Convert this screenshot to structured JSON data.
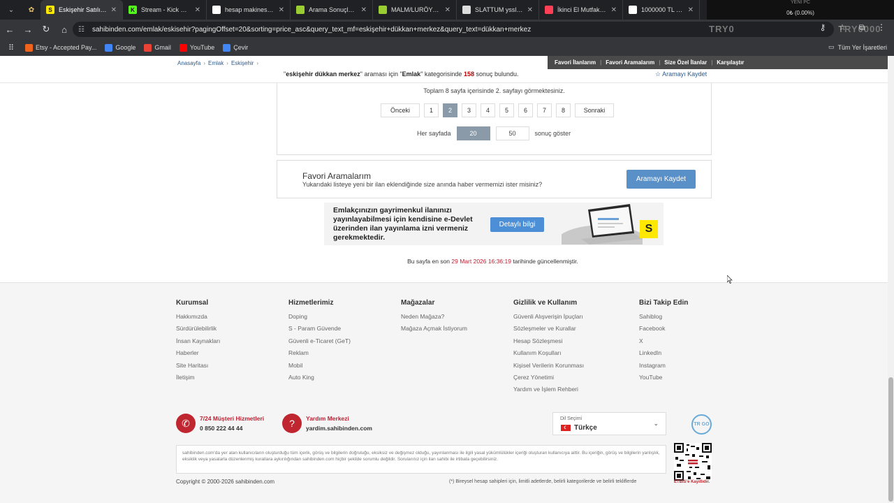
{
  "browser": {
    "tabs": [
      {
        "title": "Eskişehir Satılık, Kira",
        "icon": "sahibinden-icon",
        "active": true,
        "color": "#ffe800"
      },
      {
        "title": "Stream - Kick Dashb",
        "icon": "kick-icon",
        "active": false,
        "color": "#53fc18"
      },
      {
        "title": "hesap makinesi - Go",
        "icon": "google-icon",
        "active": false,
        "color": "#ffffff"
      },
      {
        "title": "Arama Sonuçları | İK",
        "icon": "ikea-icon",
        "active": false,
        "color": "#9acd32"
      },
      {
        "title": "MALM/LURÖY beya",
        "icon": "ikea-icon",
        "active": false,
        "color": "#9acd32"
      },
      {
        "title": "SLATTUM yssle koy",
        "icon": "page-icon",
        "active": false,
        "color": "#dddddd"
      },
      {
        "title": "İkinci El Mutfak Ma",
        "icon": "letgo-icon",
        "active": false,
        "color": "#ff3f55"
      },
      {
        "title": "1000000 TL 12 Ay Va",
        "icon": "bank-icon",
        "active": false,
        "color": "#ffffff"
      }
    ],
    "ticker": {
      "line1": "YENİ PC",
      "line2": "0₺ (0.00%)"
    },
    "url": "sahibinden.com/emlak/eskisehir?pagingOffset=20&sorting=price_asc&query_text_mf=eskişehir+dükkan+merkez&query_text=dükkan+merkez",
    "overlay_text": "TRY0",
    "overlay_text2": "TRY0000",
    "bookmarks": [
      {
        "label": "Etsy - Accepted Pay...",
        "icon": "etsy-icon",
        "color": "#f1641e"
      },
      {
        "label": "Google",
        "icon": "google-icon",
        "color": "#4285f4"
      },
      {
        "label": "Gmail",
        "icon": "gmail-icon",
        "color": "#ea4335"
      },
      {
        "label": "YouTube",
        "icon": "youtube-icon",
        "color": "#ff0000"
      },
      {
        "label": "Çevir",
        "icon": "translate-icon",
        "color": "#4285f4"
      }
    ],
    "all_bookmarks": "Tüm Yer İşaretleri"
  },
  "breadcrumb": [
    "Anasayfa",
    "Emlak",
    "Eskişehir"
  ],
  "topnav": [
    "Favori İlanlarım",
    "Favori Aramalarım",
    "Size Özel İlanlar",
    "Karşılaştır"
  ],
  "results": {
    "query": "eskişehir dükkan merkez",
    "pre": "\"",
    "mid1": "\" araması için \"",
    "category": "Emlak",
    "mid2": "\" kategorisinde",
    "count": "158",
    "post": "sonuç bulundu.",
    "save": "Aramayı Kaydet"
  },
  "pagination": {
    "info": "Toplam 8 sayfa içerisinde 2. sayfayı görmektesiniz.",
    "prev": "Önceki",
    "next": "Sonraki",
    "pages": [
      "1",
      "2",
      "3",
      "4",
      "5",
      "6",
      "7",
      "8"
    ],
    "current": "2",
    "per_page_label": "Her sayfada",
    "per_page_options": [
      "20",
      "50"
    ],
    "per_page_selected": "20",
    "per_page_suffix": "sonuç göster"
  },
  "favorites": {
    "title": "Favori Aramalarım",
    "desc": "Yukarıdaki listeye yeni bir ilan eklendiğinde size anında haber vermemizi ister misiniz?",
    "button": "Aramayı Kaydet"
  },
  "banner": {
    "text": "Emlakçınızın gayrimenkul ilanınızı yayınlayabilmesi için kendisine e-Devlet üzerinden ilan yayınlama izni vermeniz gerekmektedir.",
    "button": "Detaylı bilgi",
    "logo": "S"
  },
  "updated": {
    "pre": "Bu sayfa en son",
    "date": "29 Mart 2026 16:36:19",
    "post": "tarihinde güncellenmiştir."
  },
  "footer": {
    "columns": [
      {
        "title": "Kurumsal",
        "items": [
          "Hakkımızda",
          "Sürdürülebilirlik",
          "İnsan Kaynakları",
          "Haberler",
          "Site Haritası",
          "İletişim"
        ]
      },
      {
        "title": "Hizmetlerimiz",
        "items": [
          "Doping",
          "S - Param Güvende",
          "Güvenli e-Ticaret (GeT)",
          "Reklam",
          "Mobil",
          "Auto King"
        ]
      },
      {
        "title": "Mağazalar",
        "items": [
          "Neden Mağaza?",
          "Mağaza Açmak İstiyorum"
        ]
      },
      {
        "title": "Gizlilik ve Kullanım",
        "items": [
          "Güvenli Alışverişin İpuçları",
          "Sözleşmeler ve Kurallar",
          "Hesap Sözleşmesi",
          "Kullanım Koşulları",
          "Kişisel Verilerin Korunması",
          "Çerez Yönetimi",
          "Yardım ve İşlem Rehberi"
        ]
      },
      {
        "title": "Bizi Takip Edin",
        "items": [
          "Sahiblog",
          "Facebook",
          "X",
          "LinkedIn",
          "Instagram",
          "YouTube"
        ]
      }
    ],
    "support": {
      "title": "7/24 Müşteri Hizmetleri",
      "value": "0 850 222 44 44"
    },
    "help": {
      "title": "Yardım Merkezi",
      "value": "yardim.sahibinden.com"
    },
    "language": {
      "label": "Dil Seçimi",
      "value": "Türkçe"
    },
    "trgo": "TR GO",
    "disclaimer": "sahibinden.com'da yer alan kullanıcıların oluşturduğu tüm içerik, görüş ve bilgilerin doğruluğu, eksiksiz ve değişmez olduğu, yayınlanması ile ilgili yasal yükümlülükler içeriği oluşturan kullanıcıya aittir. Bu içeriğin, görüş ve bilgilerin yanlışlık, eksiklik veya yasalarla düzenlenmiş kurallara aykırılığından sahibinden.com hiçbir şekilde sorumlu değildir. Sorularınız için ilan sahibi ile irtibata geçebilirsiniz.",
    "etbis": "ETBİS'e Kayıtlıdır.",
    "copyright": "Copyright © 2000-2026 sahibinden.com",
    "note": "(*) Bireysel hesap sahipleri için, limitli adetlerde, belirli kategorilerde ve belirli tekliflerde"
  },
  "colors": {
    "accent": "#5a90c8",
    "brand_yellow": "#ffe800",
    "footer_red": "#c0262f",
    "active_page": "#8a9aa8"
  }
}
